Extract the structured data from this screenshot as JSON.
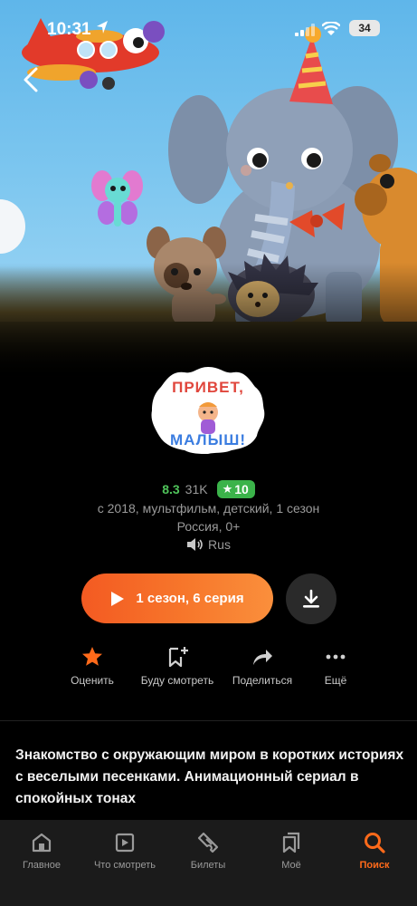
{
  "status_bar": {
    "time": "10:31",
    "battery": "34"
  },
  "show": {
    "logo_alt": "ПРИВЕТ, МАЛЫШ!",
    "logo_line1": "ПРИВЕТ,",
    "logo_line2": "МАЛЫШ!",
    "rating": "8.3",
    "votes": "31K",
    "badge": "10",
    "meta_line1": "с 2018, мультфильм, детский, 1 сезон",
    "meta_line2": "Россия, 0+",
    "audio": "Rus"
  },
  "actions": {
    "play_label": "1 сезон, 6 серия",
    "quick": [
      {
        "label": "Оценить",
        "icon": "star-icon"
      },
      {
        "label": "Буду смотреть",
        "icon": "bookmark-add-icon"
      },
      {
        "label": "Поделиться",
        "icon": "share-icon"
      },
      {
        "label": "Ещё",
        "icon": "more-icon"
      }
    ]
  },
  "description": "Знакомство с окружающим миром в коротких историях с веселыми песенками. Анимационный сериал в спокойных тонах",
  "tabbar": [
    {
      "label": "Главное",
      "icon": "home-icon"
    },
    {
      "label": "Что смотреть",
      "icon": "play-square-icon"
    },
    {
      "label": "Билеты",
      "icon": "ticket-icon"
    },
    {
      "label": "Моё",
      "icon": "bookmarks-icon"
    },
    {
      "label": "Поиск",
      "icon": "search-icon",
      "active": true
    }
  ],
  "colors": {
    "accent": "#ff6a1a",
    "rating_green": "#4fc35a",
    "badge_green": "#3bb34a"
  }
}
